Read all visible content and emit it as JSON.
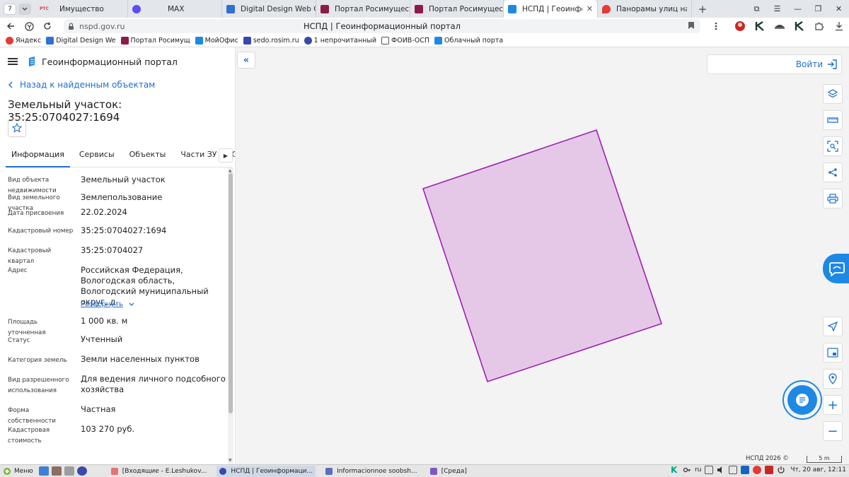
{
  "browser": {
    "tab_count": "7",
    "tabs": [
      {
        "label": "Имущество",
        "color": "#e53935",
        "favtext": "РТС"
      },
      {
        "label": "MAX",
        "color": "#5b4cf0"
      },
      {
        "label": "Digital Design Web Client",
        "color": "#2f6fd6"
      },
      {
        "label": "Портал Росимущества",
        "color": "#8e1a4c"
      },
      {
        "label": "Портал Росимущества",
        "color": "#8e1a4c"
      },
      {
        "label": "НСПД | Геоинформац...",
        "color": "#1e88e5",
        "active": true
      },
      {
        "label": "Панорамы улиц на карте",
        "color": "#e53935"
      }
    ],
    "url_domain": "nspd.gov.ru",
    "page_title": "НСПД | Геоинформационный портал",
    "bookmarks": [
      {
        "label": "Яндекс",
        "color": "#e53935"
      },
      {
        "label": "Digital Design We",
        "color": "#2f6fd6"
      },
      {
        "label": "Портал Росимущ",
        "color": "#8e1a4c"
      },
      {
        "label": "МойОфис",
        "color": "#1e88e5"
      },
      {
        "label": "sedo.rosim.ru",
        "color": "#3949ab"
      },
      {
        "label": "1 непрочитанный",
        "color": "#3949ab"
      },
      {
        "label": "ФОИВ-ОСП",
        "color": "#555555"
      },
      {
        "label": "Облачный порта",
        "color": "#1e88e5"
      }
    ]
  },
  "panel": {
    "portal_title": "Геоинформационный портал",
    "back_link": "Назад к найденным объектам",
    "object_title": "Земельный участок: 35:25:0704027:1694",
    "tabs": [
      "Информация",
      "Сервисы",
      "Объекты",
      "Части ЗУ",
      "Состав"
    ],
    "properties": [
      {
        "label": "Вид объекта недвижимости",
        "value": "Земельный участок"
      },
      {
        "label": "Вид земельного участка",
        "value": "Землепользование"
      },
      {
        "label": "Дата присвоения",
        "value": "22.02.2024"
      },
      {
        "label": "Кадастровый номер",
        "value": "35:25:0704027:1694"
      },
      {
        "label": "Кадастровый квартал",
        "value": "35:25:0704027"
      },
      {
        "label": "Адрес",
        "value": "Российская Федерация, Вологодская область, Вологодский муниципальный округ, д.",
        "expand": "Развернуть"
      },
      {
        "label": "Площадь уточненная",
        "value": "1 000 кв. м"
      },
      {
        "label": "Статус",
        "value": "Учтенный"
      },
      {
        "label": "Категория земель",
        "value": "Земли населенных пунктов"
      },
      {
        "label": "Вид разрешенного использования",
        "value": "Для ведения личного подсобного хозяйства"
      },
      {
        "label": "Форма собственности",
        "value": "Частная"
      },
      {
        "label": "Кадастровая стоимость",
        "value": "103 270 руб."
      }
    ]
  },
  "map": {
    "login_label": "Войти",
    "attribution": "НСПД 2026 ©",
    "scale_label": "5 m",
    "parcel_fill": "#e5c8e8",
    "parcel_stroke": "#a020b0"
  },
  "taskbar": {
    "start_label": "Меню",
    "tasks": [
      {
        "label": "[Входящие - E.Leshukov...",
        "color": "#e57373"
      },
      {
        "label": "НСПД | Геоинформаци...",
        "color": "#3949ab",
        "active": true
      },
      {
        "label": "Informacionnoe soobsh...",
        "color": "#5c6bc0"
      },
      {
        "label": "[Среда]",
        "color": "#7e57c2"
      }
    ],
    "lang": "ru",
    "clock": "Чт, 20 авг, 12:11"
  }
}
